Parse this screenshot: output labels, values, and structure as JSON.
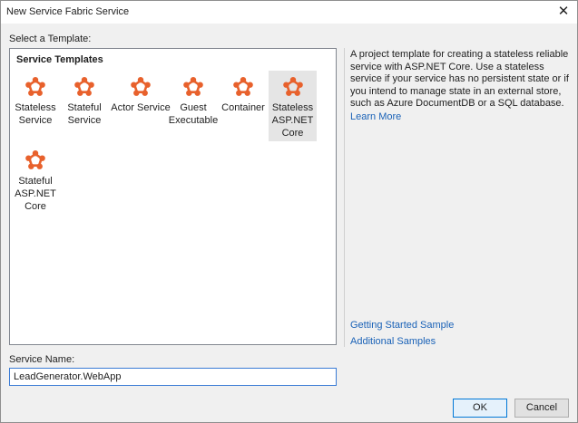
{
  "window": {
    "title": "New Service Fabric Service",
    "close_glyph": "✕"
  },
  "select_label": "Select a Template:",
  "templates_group": {
    "title": "Service Templates",
    "icon": "service-fabric-icon",
    "icon_color": "#e8612c",
    "items": [
      {
        "label": "Stateless\nService",
        "selected": false
      },
      {
        "label": "Stateful\nService",
        "selected": false
      },
      {
        "label": "Actor Service",
        "selected": false
      },
      {
        "label": "Guest\nExecutable",
        "selected": false
      },
      {
        "label": "Container",
        "selected": false
      },
      {
        "label": "Stateless\nASP.NET\nCore",
        "selected": true
      },
      {
        "label": "Stateful\nASP.NET\nCore",
        "selected": false
      }
    ]
  },
  "description": {
    "text": "A project template for creating a stateless reliable service with ASP.NET Core. Use a stateless service if your service has no persistent state or if you intend to manage state in an external store, such as Azure DocumentDB or a SQL database.",
    "learn_more": "Learn More",
    "getting_started": "Getting Started Sample",
    "additional_samples": "Additional Samples"
  },
  "service_name": {
    "label": "Service Name:",
    "value": "LeadGenerator.WebApp"
  },
  "buttons": {
    "ok": "OK",
    "cancel": "Cancel"
  }
}
